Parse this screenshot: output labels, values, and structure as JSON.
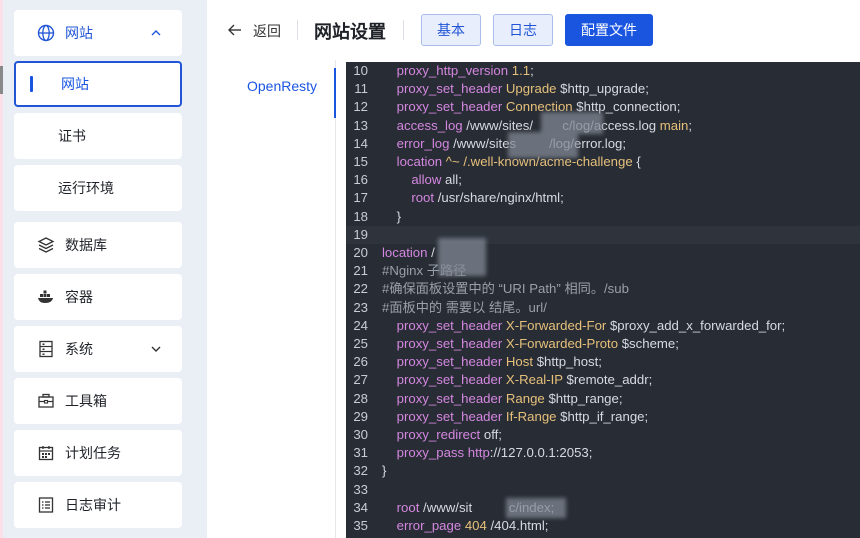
{
  "sidebar": {
    "items": [
      {
        "label": "网站",
        "icon": "globe-icon",
        "expanded": true
      },
      {
        "label": "网站",
        "active": true
      },
      {
        "label": "证书"
      },
      {
        "label": "运行环境"
      },
      {
        "label": "数据库",
        "icon": "database-layers-icon"
      },
      {
        "label": "容器",
        "icon": "docker-whale-icon"
      },
      {
        "label": "系统",
        "icon": "server-icon"
      },
      {
        "label": "工具箱",
        "icon": "toolbox-icon"
      },
      {
        "label": "计划任务",
        "icon": "calendar-icon"
      },
      {
        "label": "日志审计",
        "icon": "log-list-icon"
      }
    ]
  },
  "header": {
    "back_label": "返回",
    "title": "网站设置",
    "buttons": {
      "basic": "基本",
      "log": "日志",
      "config": "配置文件"
    }
  },
  "tabs": {
    "openresty": "OpenResty"
  },
  "colors": {
    "accent": "#1a55e0",
    "editor_bg": "#282c34",
    "keyword": "#d487e0",
    "directive_arg": "#e6c07b"
  },
  "editor": {
    "lines": [
      {
        "n": "10",
        "text": "    proxy_http_version 1.1;"
      },
      {
        "n": "11",
        "text": "    proxy_set_header Upgrade $http_upgrade;"
      },
      {
        "n": "12",
        "text": "    proxy_set_header Connection $http_connection;"
      },
      {
        "n": "13",
        "text": "    access_log /www/sites/        c/log/access.log main;"
      },
      {
        "n": "14",
        "text": "    error_log /www/sites         /log/error.log;"
      },
      {
        "n": "15",
        "text": "    location ^~ /.well-known/acme-challenge {"
      },
      {
        "n": "16",
        "text": "        allow all;"
      },
      {
        "n": "17",
        "text": "        root /usr/share/nginx/html;"
      },
      {
        "n": "18",
        "text": "    }"
      },
      {
        "n": "19",
        "text": ""
      },
      {
        "n": "20",
        "text": "location /"
      },
      {
        "n": "21",
        "text": "#Nginx 子路径"
      },
      {
        "n": "22",
        "text": "#确保面板设置中的 “URI Path” 相同。/sub"
      },
      {
        "n": "23",
        "text": "#面板中的 需要以 结尾。url/"
      },
      {
        "n": "24",
        "text": "    proxy_set_header X-Forwarded-For $proxy_add_x_forwarded_for;"
      },
      {
        "n": "25",
        "text": "    proxy_set_header X-Forwarded-Proto $scheme;"
      },
      {
        "n": "26",
        "text": "    proxy_set_header Host $http_host;"
      },
      {
        "n": "27",
        "text": "    proxy_set_header X-Real-IP $remote_addr;"
      },
      {
        "n": "28",
        "text": "    proxy_set_header Range $http_range;"
      },
      {
        "n": "29",
        "text": "    proxy_set_header If-Range $http_if_range;"
      },
      {
        "n": "30",
        "text": "    proxy_redirect off;"
      },
      {
        "n": "31",
        "text": "    proxy_pass http://127.0.0.1:2053;"
      },
      {
        "n": "32",
        "text": "}"
      },
      {
        "n": "33",
        "text": ""
      },
      {
        "n": "34",
        "text": "    root /www/sit          c/index;"
      },
      {
        "n": "35",
        "text": "    error_page 404 /404.html;"
      }
    ]
  }
}
